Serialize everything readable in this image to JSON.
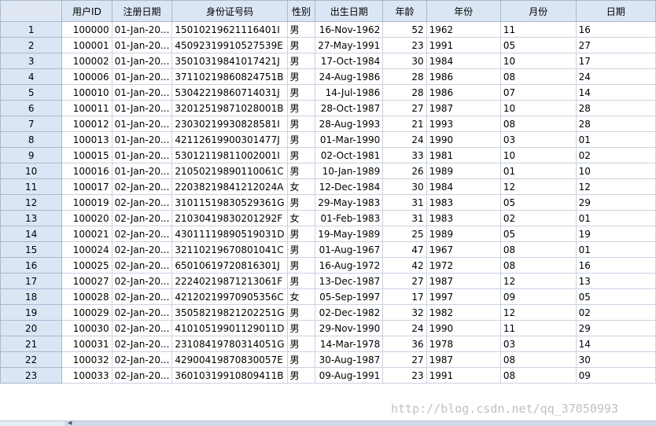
{
  "columns": [
    "用户ID",
    "注册日期",
    "身份证号码",
    "性别",
    "出生日期",
    "年龄",
    "年份",
    "月份",
    "日期"
  ],
  "rows": [
    {
      "n": "1",
      "id": "100000",
      "reg": "01-Jan-20...",
      "idcard": "15010219621116401I",
      "sex": "男",
      "birth": "16-Nov-1962",
      "age": "52",
      "year": "1962",
      "month": "11",
      "day": "16"
    },
    {
      "n": "2",
      "id": "100001",
      "reg": "01-Jan-20...",
      "idcard": "45092319910527539E",
      "sex": "男",
      "birth": "27-May-1991",
      "age": "23",
      "year": "1991",
      "month": "05",
      "day": "27"
    },
    {
      "n": "3",
      "id": "100002",
      "reg": "01-Jan-20...",
      "idcard": "35010319841017421J",
      "sex": "男",
      "birth": "17-Oct-1984",
      "age": "30",
      "year": "1984",
      "month": "10",
      "day": "17"
    },
    {
      "n": "4",
      "id": "100006",
      "reg": "01-Jan-20...",
      "idcard": "37110219860824751B",
      "sex": "男",
      "birth": "24-Aug-1986",
      "age": "28",
      "year": "1986",
      "month": "08",
      "day": "24"
    },
    {
      "n": "5",
      "id": "100010",
      "reg": "01-Jan-20...",
      "idcard": "53042219860714031J",
      "sex": "男",
      "birth": "14-Jul-1986",
      "age": "28",
      "year": "1986",
      "month": "07",
      "day": "14"
    },
    {
      "n": "6",
      "id": "100011",
      "reg": "01-Jan-20...",
      "idcard": "32012519871028001B",
      "sex": "男",
      "birth": "28-Oct-1987",
      "age": "27",
      "year": "1987",
      "month": "10",
      "day": "28"
    },
    {
      "n": "7",
      "id": "100012",
      "reg": "01-Jan-20...",
      "idcard": "23030219930828581I",
      "sex": "男",
      "birth": "28-Aug-1993",
      "age": "21",
      "year": "1993",
      "month": "08",
      "day": "28"
    },
    {
      "n": "8",
      "id": "100013",
      "reg": "01-Jan-20...",
      "idcard": "42112619900301477J",
      "sex": "男",
      "birth": "01-Mar-1990",
      "age": "24",
      "year": "1990",
      "month": "03",
      "day": "01"
    },
    {
      "n": "9",
      "id": "100015",
      "reg": "01-Jan-20...",
      "idcard": "53012119811002001I",
      "sex": "男",
      "birth": "02-Oct-1981",
      "age": "33",
      "year": "1981",
      "month": "10",
      "day": "02"
    },
    {
      "n": "10",
      "id": "100016",
      "reg": "01-Jan-20...",
      "idcard": "21050219890110061C",
      "sex": "男",
      "birth": "10-Jan-1989",
      "age": "26",
      "year": "1989",
      "month": "01",
      "day": "10"
    },
    {
      "n": "11",
      "id": "100017",
      "reg": "02-Jan-20...",
      "idcard": "22038219841212024A",
      "sex": "女",
      "birth": "12-Dec-1984",
      "age": "30",
      "year": "1984",
      "month": "12",
      "day": "12"
    },
    {
      "n": "12",
      "id": "100019",
      "reg": "02-Jan-20...",
      "idcard": "31011519830529361G",
      "sex": "男",
      "birth": "29-May-1983",
      "age": "31",
      "year": "1983",
      "month": "05",
      "day": "29"
    },
    {
      "n": "13",
      "id": "100020",
      "reg": "02-Jan-20...",
      "idcard": "21030419830201292F",
      "sex": "女",
      "birth": "01-Feb-1983",
      "age": "31",
      "year": "1983",
      "month": "02",
      "day": "01"
    },
    {
      "n": "14",
      "id": "100021",
      "reg": "02-Jan-20...",
      "idcard": "43011119890519031D",
      "sex": "男",
      "birth": "19-May-1989",
      "age": "25",
      "year": "1989",
      "month": "05",
      "day": "19"
    },
    {
      "n": "15",
      "id": "100024",
      "reg": "02-Jan-20...",
      "idcard": "32110219670801041C",
      "sex": "男",
      "birth": "01-Aug-1967",
      "age": "47",
      "year": "1967",
      "month": "08",
      "day": "01"
    },
    {
      "n": "16",
      "id": "100025",
      "reg": "02-Jan-20...",
      "idcard": "65010619720816301J",
      "sex": "男",
      "birth": "16-Aug-1972",
      "age": "42",
      "year": "1972",
      "month": "08",
      "day": "16"
    },
    {
      "n": "17",
      "id": "100027",
      "reg": "02-Jan-20...",
      "idcard": "22240219871213061F",
      "sex": "男",
      "birth": "13-Dec-1987",
      "age": "27",
      "year": "1987",
      "month": "12",
      "day": "13"
    },
    {
      "n": "18",
      "id": "100028",
      "reg": "02-Jan-20...",
      "idcard": "42120219970905356C",
      "sex": "女",
      "birth": "05-Sep-1997",
      "age": "17",
      "year": "1997",
      "month": "09",
      "day": "05"
    },
    {
      "n": "19",
      "id": "100029",
      "reg": "02-Jan-20...",
      "idcard": "35058219821202251G",
      "sex": "男",
      "birth": "02-Dec-1982",
      "age": "32",
      "year": "1982",
      "month": "12",
      "day": "02"
    },
    {
      "n": "20",
      "id": "100030",
      "reg": "02-Jan-20...",
      "idcard": "41010519901129011D",
      "sex": "男",
      "birth": "29-Nov-1990",
      "age": "24",
      "year": "1990",
      "month": "11",
      "day": "29"
    },
    {
      "n": "21",
      "id": "100031",
      "reg": "02-Jan-20...",
      "idcard": "23108419780314051G",
      "sex": "男",
      "birth": "14-Mar-1978",
      "age": "36",
      "year": "1978",
      "month": "03",
      "day": "14"
    },
    {
      "n": "22",
      "id": "100032",
      "reg": "02-Jan-20...",
      "idcard": "42900419870830057E",
      "sex": "男",
      "birth": "30-Aug-1987",
      "age": "27",
      "year": "1987",
      "month": "08",
      "day": "30"
    },
    {
      "n": "23",
      "id": "100033",
      "reg": "02-Jan-20...",
      "idcard": "36010319910809411B",
      "sex": "男",
      "birth": "09-Aug-1991",
      "age": "23",
      "year": "1991",
      "month": "08",
      "day": "09"
    }
  ],
  "watermark": "http://blog.csdn.net/qq_37050993"
}
